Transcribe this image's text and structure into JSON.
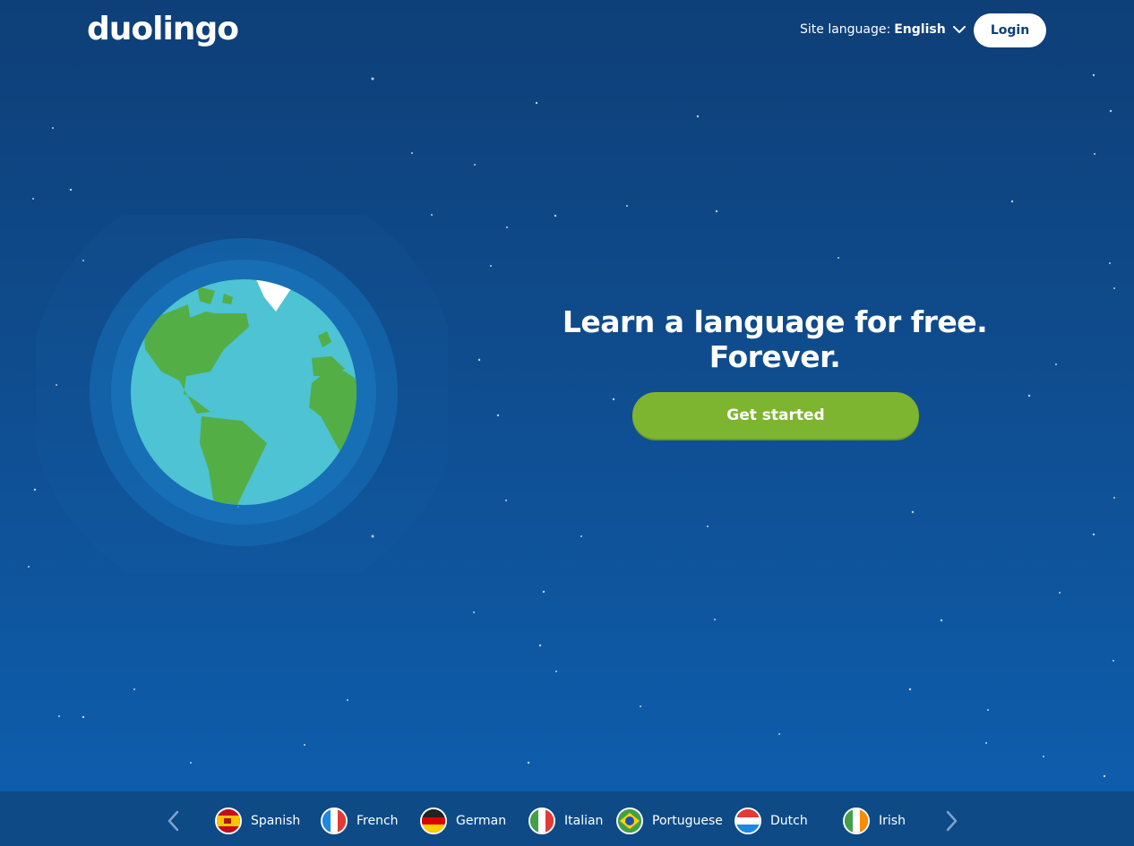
{
  "header": {
    "logo_text": "duolingo",
    "site_language_label": "Site language:",
    "site_language_value": "English",
    "login_label": "Login"
  },
  "hero": {
    "headline": "Learn a language for free. Forever.",
    "cta_label": "Get started"
  },
  "languages": [
    {
      "label": "Spanish",
      "flag": "spain-flag-icon"
    },
    {
      "label": "French",
      "flag": "france-flag-icon"
    },
    {
      "label": "German",
      "flag": "germany-flag-icon"
    },
    {
      "label": "Italian",
      "flag": "italy-flag-icon"
    },
    {
      "label": "Portuguese",
      "flag": "brazil-flag-icon"
    },
    {
      "label": "Dutch",
      "flag": "netherlands-flag-icon"
    },
    {
      "label": "Irish",
      "flag": "ireland-flag-icon"
    }
  ],
  "colors": {
    "background_top": "#0e3f78",
    "background_bottom": "#0e5fb0",
    "cta": "#7eb530",
    "ocean": "#4dc3d3",
    "land": "#53ae46",
    "language_bar": "#0e4a86"
  }
}
